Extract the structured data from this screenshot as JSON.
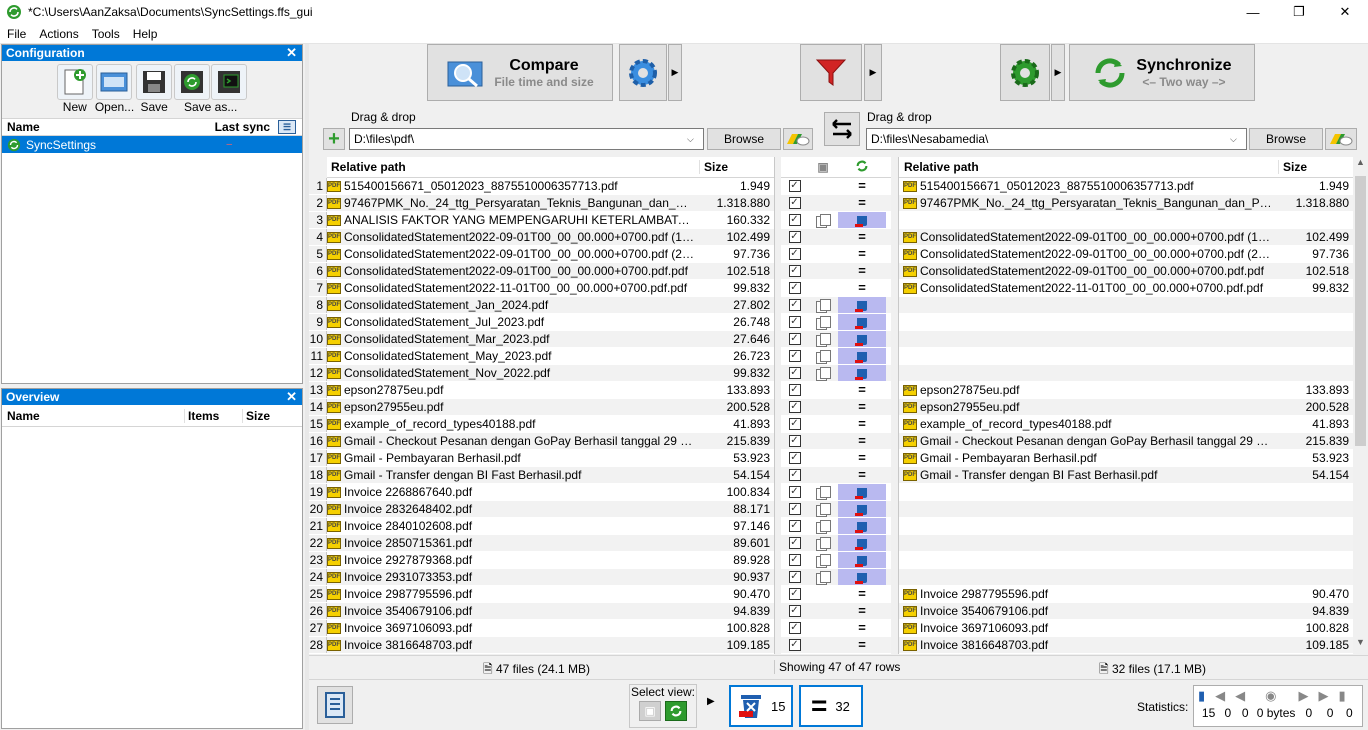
{
  "window": {
    "title": "*C:\\Users\\AanZaksa\\Documents\\SyncSettings.ffs_gui"
  },
  "menu": [
    "File",
    "Actions",
    "Tools",
    "Help"
  ],
  "config": {
    "header": "Configuration",
    "buttons": [
      "New",
      "Open...",
      "Save",
      "Save as..."
    ],
    "col_name": "Name",
    "col_lastsync": "Last sync",
    "item": "SyncSettings",
    "item_lastsync": "–"
  },
  "overview": {
    "header": "Overview",
    "col_name": "Name",
    "col_items": "Items",
    "col_size": "Size"
  },
  "toolbar": {
    "compare_title": "Compare",
    "compare_sub": "File time and size",
    "sync_title": "Synchronize",
    "sync_sub": "<– Two way –>"
  },
  "left_folder": {
    "label": "Drag & drop",
    "path": "D:\\files\\pdf\\",
    "browse": "Browse"
  },
  "right_folder": {
    "label": "Drag & drop",
    "path": "D:\\files\\Nesabamedia\\",
    "browse": "Browse"
  },
  "grid": {
    "left_col_path": "Relative path",
    "left_col_size": "Size",
    "right_col_path": "Relative path",
    "right_col_size": "Size",
    "rows": [
      {
        "n": "1",
        "l": "515400156671_05012023_8875510006357713.pdf",
        "ls": "1.949",
        "r": "515400156671_05012023_8875510006357713.pdf",
        "rs": "1.949",
        "op": "equal"
      },
      {
        "n": "2",
        "l": "97467PMK_No._24_ttg_Persyaratan_Teknis_Bangunan_dan_Prasar...",
        "ls": "1.318.880",
        "r": "97467PMK_No._24_ttg_Persyaratan_Teknis_Bangunan_dan_Prasara...",
        "rs": "1.318.880",
        "op": "equal"
      },
      {
        "n": "3",
        "l": "ANALISIS FAKTOR YANG MEMPENGARUHI KETERLAMBATAN DA...",
        "ls": "160.332",
        "r": "",
        "rs": "",
        "op": "delete"
      },
      {
        "n": "4",
        "l": "ConsolidatedStatement2022-09-01T00_00_00.000+0700.pdf (1).pdf",
        "ls": "102.499",
        "r": "ConsolidatedStatement2022-09-01T00_00_00.000+0700.pdf (1).pdf",
        "rs": "102.499",
        "op": "equal"
      },
      {
        "n": "5",
        "l": "ConsolidatedStatement2022-09-01T00_00_00.000+0700.pdf (2).pdf",
        "ls": "97.736",
        "r": "ConsolidatedStatement2022-09-01T00_00_00.000+0700.pdf (2).pdf",
        "rs": "97.736",
        "op": "equal"
      },
      {
        "n": "6",
        "l": "ConsolidatedStatement2022-09-01T00_00_00.000+0700.pdf.pdf",
        "ls": "102.518",
        "r": "ConsolidatedStatement2022-09-01T00_00_00.000+0700.pdf.pdf",
        "rs": "102.518",
        "op": "equal"
      },
      {
        "n": "7",
        "l": "ConsolidatedStatement2022-11-01T00_00_00.000+0700.pdf.pdf",
        "ls": "99.832",
        "r": "ConsolidatedStatement2022-11-01T00_00_00.000+0700.pdf.pdf",
        "rs": "99.832",
        "op": "equal"
      },
      {
        "n": "8",
        "l": "ConsolidatedStatement_Jan_2024.pdf",
        "ls": "27.802",
        "r": "",
        "rs": "",
        "op": "delete"
      },
      {
        "n": "9",
        "l": "ConsolidatedStatement_Jul_2023.pdf",
        "ls": "26.748",
        "r": "",
        "rs": "",
        "op": "delete"
      },
      {
        "n": "10",
        "l": "ConsolidatedStatement_Mar_2023.pdf",
        "ls": "27.646",
        "r": "",
        "rs": "",
        "op": "delete"
      },
      {
        "n": "11",
        "l": "ConsolidatedStatement_May_2023.pdf",
        "ls": "26.723",
        "r": "",
        "rs": "",
        "op": "delete"
      },
      {
        "n": "12",
        "l": "ConsolidatedStatement_Nov_2022.pdf",
        "ls": "99.832",
        "r": "",
        "rs": "",
        "op": "delete"
      },
      {
        "n": "13",
        "l": "epson27875eu.pdf",
        "ls": "133.893",
        "r": "epson27875eu.pdf",
        "rs": "133.893",
        "op": "equal"
      },
      {
        "n": "14",
        "l": "epson27955eu.pdf",
        "ls": "200.528",
        "r": "epson27955eu.pdf",
        "rs": "200.528",
        "op": "equal"
      },
      {
        "n": "15",
        "l": "example_of_record_types40188.pdf",
        "ls": "41.893",
        "r": "example_of_record_types40188.pdf",
        "rs": "41.893",
        "op": "equal"
      },
      {
        "n": "16",
        "l": "Gmail - Checkout Pesanan dengan GoPay Berhasil tanggal 29 Feb...",
        "ls": "215.839",
        "r": "Gmail - Checkout Pesanan dengan GoPay Berhasil tanggal 29 Feb...",
        "rs": "215.839",
        "op": "equal"
      },
      {
        "n": "17",
        "l": "Gmail - Pembayaran Berhasil.pdf",
        "ls": "53.923",
        "r": "Gmail - Pembayaran Berhasil.pdf",
        "rs": "53.923",
        "op": "equal"
      },
      {
        "n": "18",
        "l": "Gmail - Transfer dengan BI Fast Berhasil.pdf",
        "ls": "54.154",
        "r": "Gmail - Transfer dengan BI Fast Berhasil.pdf",
        "rs": "54.154",
        "op": "equal"
      },
      {
        "n": "19",
        "l": "Invoice 2268867640.pdf",
        "ls": "100.834",
        "r": "",
        "rs": "",
        "op": "delete"
      },
      {
        "n": "20",
        "l": "Invoice 2832648402.pdf",
        "ls": "88.171",
        "r": "",
        "rs": "",
        "op": "delete"
      },
      {
        "n": "21",
        "l": "Invoice 2840102608.pdf",
        "ls": "97.146",
        "r": "",
        "rs": "",
        "op": "delete"
      },
      {
        "n": "22",
        "l": "Invoice 2850715361.pdf",
        "ls": "89.601",
        "r": "",
        "rs": "",
        "op": "delete"
      },
      {
        "n": "23",
        "l": "Invoice 2927879368.pdf",
        "ls": "89.928",
        "r": "",
        "rs": "",
        "op": "delete"
      },
      {
        "n": "24",
        "l": "Invoice 2931073353.pdf",
        "ls": "90.937",
        "r": "",
        "rs": "",
        "op": "delete"
      },
      {
        "n": "25",
        "l": "Invoice 2987795596.pdf",
        "ls": "90.470",
        "r": "Invoice 2987795596.pdf",
        "rs": "90.470",
        "op": "equal"
      },
      {
        "n": "26",
        "l": "Invoice 3540679106.pdf",
        "ls": "94.839",
        "r": "Invoice 3540679106.pdf",
        "rs": "94.839",
        "op": "equal"
      },
      {
        "n": "27",
        "l": "Invoice 3697106093.pdf",
        "ls": "100.828",
        "r": "Invoice 3697106093.pdf",
        "rs": "100.828",
        "op": "equal"
      },
      {
        "n": "28",
        "l": "Invoice 3816648703.pdf",
        "ls": "109.185",
        "r": "Invoice 3816648703.pdf",
        "rs": "109.185",
        "op": "equal"
      }
    ]
  },
  "status": {
    "left": "47 files (24.1 MB)",
    "mid": "Showing 47 of 47 rows",
    "right": "32 files (17.1 MB)"
  },
  "bottom": {
    "select_view": "Select view:",
    "delete_count": "15",
    "equal_count": "32",
    "statistics_label": "Statistics:",
    "stats": [
      "15",
      "0",
      "0",
      "0 bytes",
      "0",
      "0",
      "0"
    ]
  },
  "colors": {
    "accent": "#0078d7",
    "highlight": "#b9b9f0",
    "selected": "#0078d7"
  }
}
